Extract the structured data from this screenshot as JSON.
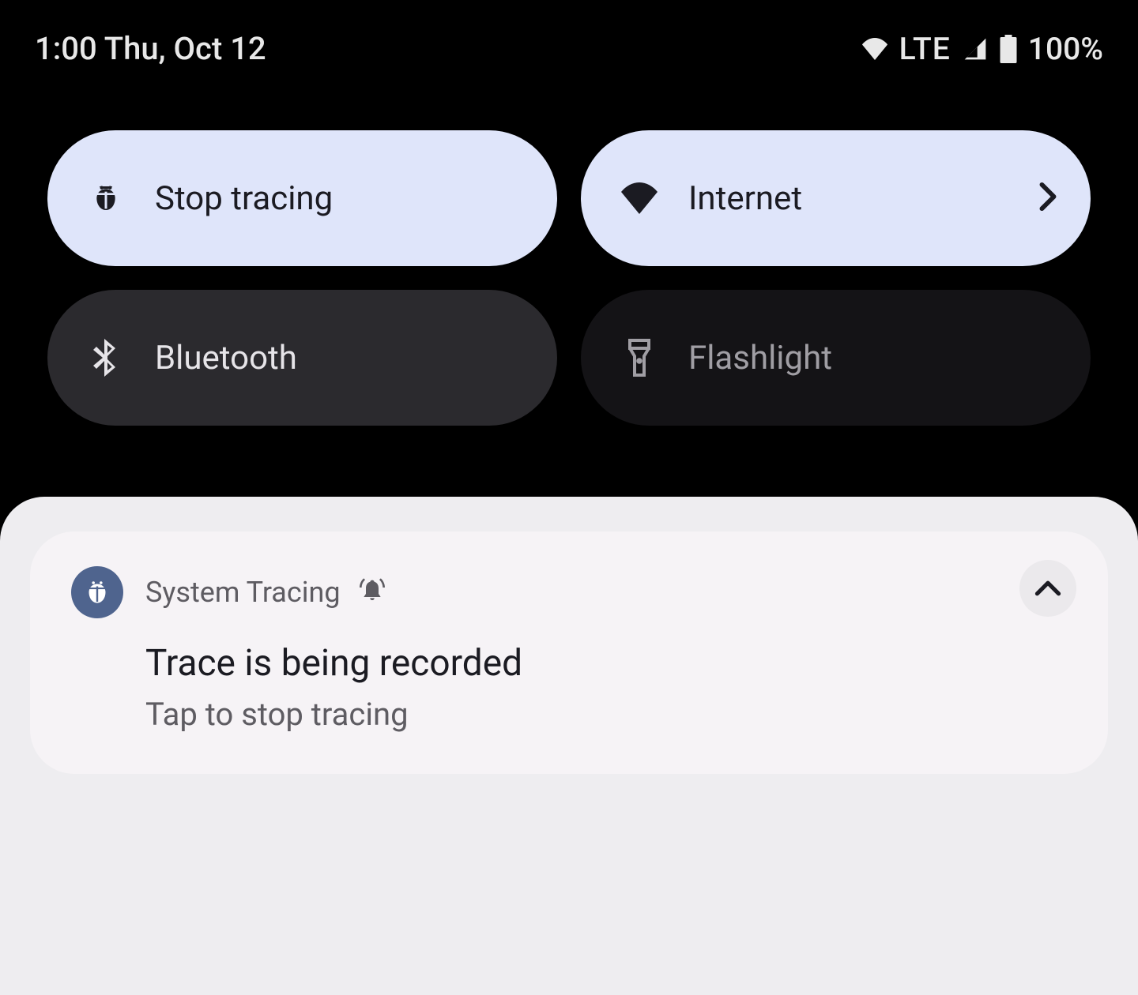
{
  "status": {
    "time_date": "1:00 Thu, Oct 12",
    "network_label": "LTE",
    "battery_pct": "100%"
  },
  "tiles": {
    "stop_tracing": {
      "label": "Stop tracing",
      "icon": "bug-icon",
      "state": "active"
    },
    "internet": {
      "label": "Internet",
      "icon": "wifi-icon",
      "state": "active",
      "has_chevron": true
    },
    "bluetooth": {
      "label": "Bluetooth",
      "icon": "bluetooth-icon",
      "state": "inactive-light"
    },
    "flashlight": {
      "label": "Flashlight",
      "icon": "flashlight-icon",
      "state": "inactive-dark"
    }
  },
  "notification": {
    "app_name": "System Tracing",
    "title": "Trace is being recorded",
    "subtitle": "Tap to stop tracing"
  },
  "colors": {
    "tile_active_bg": "#dfe5fa",
    "tile_inactive_light_bg": "#2b2a2e",
    "tile_inactive_dark_bg": "#141316",
    "panel_bg": "#eeedf0",
    "card_bg": "#f6f3f6",
    "app_icon_bg": "#4f648e"
  }
}
